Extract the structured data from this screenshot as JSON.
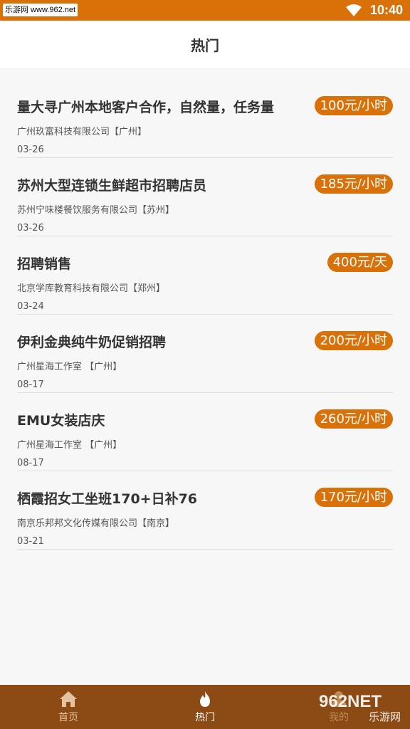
{
  "status_bar": {
    "site": "乐游网 www.962.net",
    "time": "10:40"
  },
  "header": {
    "title": "热门"
  },
  "jobs": [
    {
      "title": "量大寻广州本地客户合作，自然量，任务量",
      "salary": "100元/小时",
      "company": "广州玖富科技有限公司【广州】",
      "date": "03-26"
    },
    {
      "title": "苏州大型连锁生鲜超市招聘店员",
      "salary": "185元/小时",
      "company": "苏州宁味楼餐饮服务有限公司【苏州】",
      "date": "03-26"
    },
    {
      "title": "招聘销售",
      "salary": "400元/天",
      "company": "北京学库教育科技有限公司【郑州】",
      "date": "03-24"
    },
    {
      "title": "伊利金典纯牛奶促销招聘",
      "salary": "200元/小时",
      "company": "广州星海工作室 【广州】",
      "date": "08-17"
    },
    {
      "title": "EMU女装店庆",
      "salary": "260元/小时",
      "company": "广州星海工作室 【广州】",
      "date": "08-17"
    },
    {
      "title": "栖霞招女工坐班170+日补76",
      "salary": "170元/小时",
      "company": "南京乐邦邦文化传媒有限公司【南京】",
      "date": "03-21"
    }
  ],
  "tabbar": {
    "home": "首页",
    "hot": "热门",
    "mine": "我的"
  },
  "watermark": {
    "number": "962NET",
    "text": "乐游网"
  },
  "colors": {
    "accent": "#d97108",
    "tabbar_bg": "#8c4a14"
  }
}
